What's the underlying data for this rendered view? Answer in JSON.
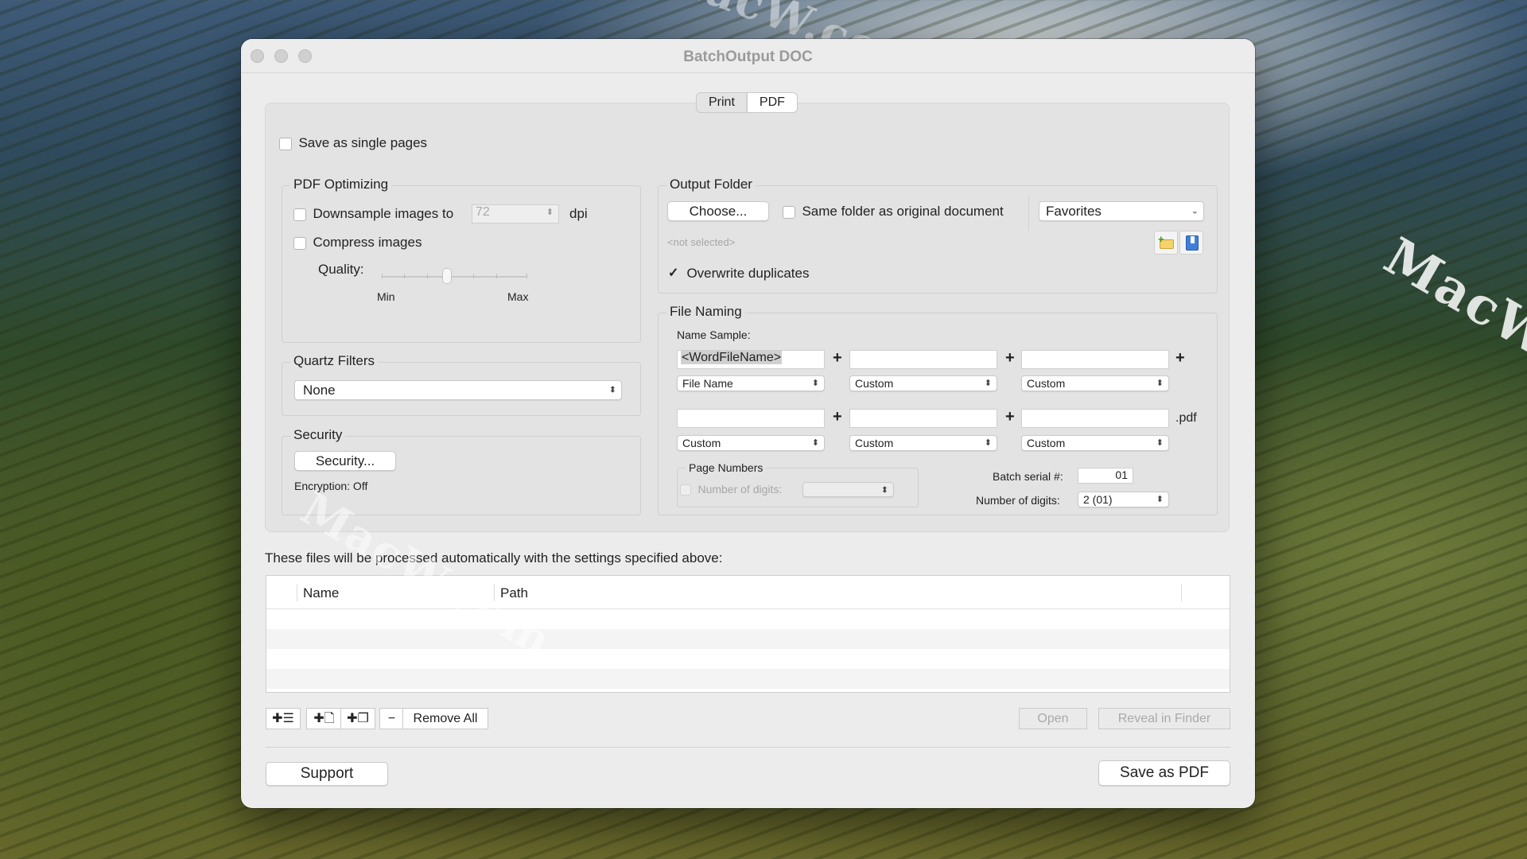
{
  "window": {
    "title": "BatchOutput DOC"
  },
  "tabs": [
    {
      "label": "Print",
      "active": false
    },
    {
      "label": "PDF",
      "active": true
    }
  ],
  "save_single_pages": {
    "label": "Save as single pages",
    "checked": false
  },
  "pdf_optimizing": {
    "title": "PDF Optimizing",
    "downsample_label": "Downsample images to",
    "downsample_value": "72",
    "dpi_label": "dpi",
    "compress_label": "Compress images",
    "quality_label": "Quality:",
    "min_label": "Min",
    "max_label": "Max",
    "quality_value": 0.45
  },
  "quartz_filters": {
    "title": "Quartz Filters",
    "selected": "None"
  },
  "security": {
    "title": "Security",
    "button": "Security...",
    "encryption": "Encryption: Off"
  },
  "output_folder": {
    "title": "Output Folder",
    "choose_button": "Choose...",
    "same_folder_label": "Same folder as original document",
    "favorites": "Favorites",
    "not_selected": "<not selected>",
    "overwrite_label": "Overwrite duplicates",
    "overwrite_checked": true
  },
  "file_naming": {
    "title": "File Naming",
    "name_sample": "Name Sample:",
    "fields_row1": [
      "<WordFileName>",
      "",
      ""
    ],
    "popups_row1": [
      "File Name",
      "Custom",
      "Custom"
    ],
    "fields_row2": [
      "",
      "",
      ""
    ],
    "popups_row2": [
      "Custom",
      "Custom",
      "Custom"
    ],
    "extension": ".pdf",
    "page_numbers_title": "Page Numbers",
    "number_of_digits_label": "Number of digits:",
    "batch_serial_label": "Batch serial #:",
    "batch_serial_value": "01",
    "digits_label": "Number of digits:",
    "digits_value": "2 (01)"
  },
  "files": {
    "caption": "These files will be processed automatically with the settings specified above:",
    "columns": [
      "Name",
      "Path"
    ]
  },
  "toolbar": {
    "remove_all": "Remove All",
    "open": "Open",
    "reveal": "Reveal in Finder"
  },
  "footer": {
    "support": "Support",
    "save_pdf": "Save as PDF"
  },
  "watermark": "MacW.com"
}
